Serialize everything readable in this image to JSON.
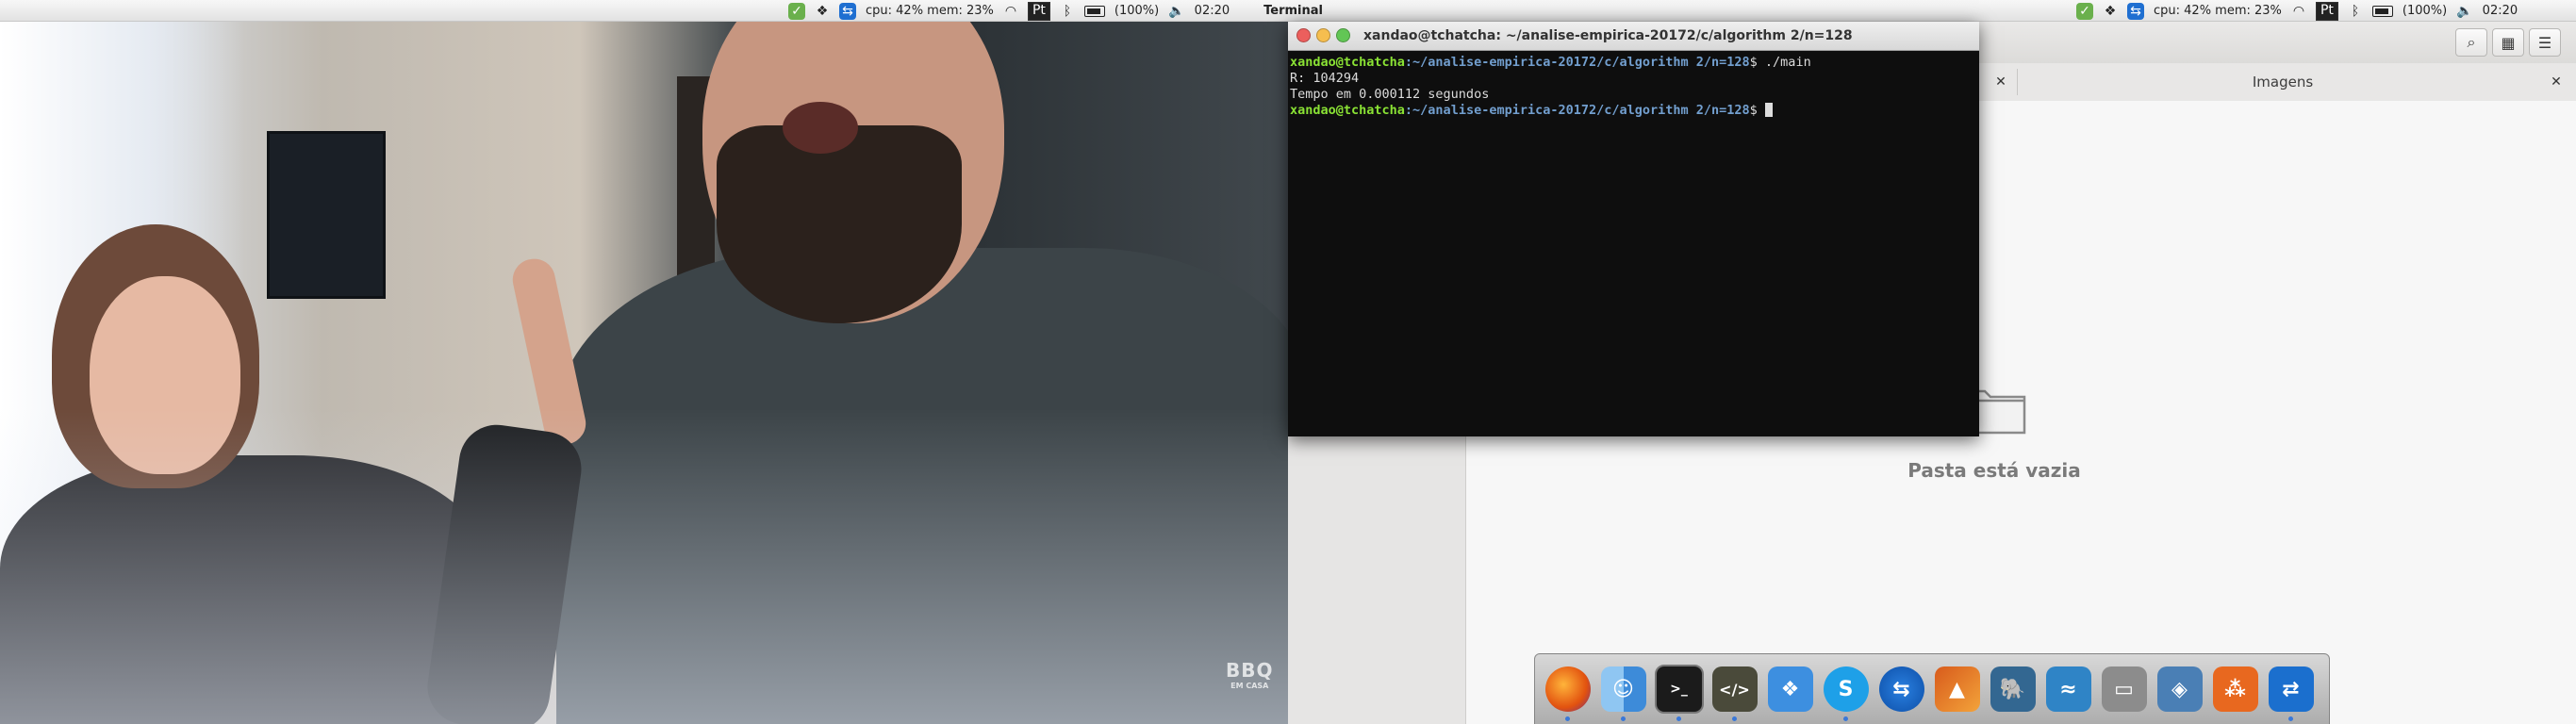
{
  "panel": {
    "left": {
      "cpu_mem": "cpu: 42% mem: 23%",
      "lang": "Pt",
      "battery": "(100%)",
      "time": "02:20",
      "app_name": "Terminal"
    },
    "right": {
      "cpu_mem": "cpu: 42% mem: 23%",
      "lang": "Pt",
      "battery": "(100%)",
      "time": "02:20"
    }
  },
  "video": {
    "watermark_big": "BBQ",
    "watermark_small": "EM CASA"
  },
  "terminal": {
    "title": "xandao@tchatcha: ~/analise-empirica-20172/c/algorithm 2/n=128",
    "lines": [
      {
        "user": "xandao@tchatcha",
        "path": ":~/analise-empirica-20172/c/algorithm 2/n=128",
        "cmd": "$ ./main"
      },
      {
        "text": "R: 104294"
      },
      {
        "text": "Tempo em 0.000112 segundos"
      },
      {
        "user": "xandao@tchatcha",
        "path": ":~/analise-empirica-20172/c/algorithm 2/n=128",
        "cmd": "$ "
      }
    ]
  },
  "file_manager": {
    "tab_title": "Imagens",
    "empty_text": "Pasta está vazia"
  },
  "dock": {
    "items": [
      "firefox-icon",
      "finder-icon",
      "terminal-icon",
      "code-editor-icon",
      "dropbox-icon",
      "skype-icon",
      "teamviewer-icon",
      "matlab-icon",
      "postgresql-icon",
      "mysql-workbench-icon",
      "scanner-icon",
      "virtualbox-icon",
      "app-grid-icon",
      "teamviewer-alt-icon"
    ]
  }
}
